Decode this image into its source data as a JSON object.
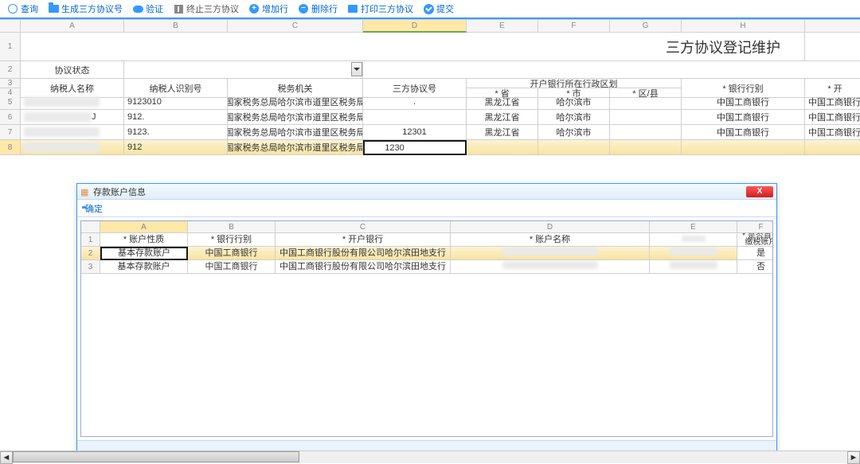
{
  "toolbar": [
    {
      "icon": "circle",
      "label": "查询"
    },
    {
      "icon": "folder",
      "label": "生成三方协议号"
    },
    {
      "icon": "cloud",
      "label": "验证"
    },
    {
      "icon": "stop",
      "label": "终止三方协议"
    },
    {
      "icon": "plus",
      "label": "增加行"
    },
    {
      "icon": "minus",
      "label": "删除行"
    },
    {
      "icon": "print",
      "label": "打印三方协议"
    },
    {
      "icon": "check",
      "label": "提交"
    }
  ],
  "col_letters": [
    "A",
    "B",
    "C",
    "D",
    "E",
    "F",
    "G",
    "H",
    ""
  ],
  "title": "三方协议登记维护",
  "status_label": "协议状态",
  "headers": {
    "taxpayer_name": "纳税人名称",
    "taxpayer_id": "纳税人识别号",
    "tax_authority": "税务机关",
    "agreement_no": "三方协议号",
    "bank_region_group": "开户银行所在行政区划",
    "province": "* 省",
    "city": "* 市",
    "district": "* 区/县",
    "bank_type": "* 银行行别",
    "open": "* 开"
  },
  "rows": [
    {
      "n": "5",
      "name": "",
      "tid": "9123010",
      "auth": "国家税务总局哈尔滨市道里区税务局",
      "agn": ".",
      "prov": "黑龙江省",
      "city": "哈尔滨市",
      "dist": "",
      "bank": "中国工商银行",
      "open": "中国工商银行"
    },
    {
      "n": "6",
      "name": "J",
      "tid": "912.",
      "auth": "国家税务总局哈尔滨市道里区税务局",
      "agn": "",
      "prov": "黑龙江省",
      "city": "哈尔滨市",
      "dist": "",
      "bank": "中国工商银行",
      "open": "中国工商银行"
    },
    {
      "n": "7",
      "name": "",
      "tid": "9123.",
      "auth": "国家税务总局哈尔滨市道里区税务局",
      "agn": "12301",
      "prov": "黑龙江省",
      "city": "哈尔滨市",
      "dist": "",
      "bank": "中国工商银行",
      "open": "中国工商银行"
    },
    {
      "n": "8",
      "name": "",
      "tid": "912",
      "auth": "国家税务总局哈尔滨市道里区税务局",
      "agn": "1230",
      "prov": "",
      "city": "",
      "dist": "",
      "bank": "",
      "open": ""
    }
  ],
  "modal": {
    "title": "存款账户信息",
    "confirm": "确定",
    "col_letters": [
      "A",
      "B",
      "C",
      "D",
      "E",
      "F"
    ],
    "headers": {
      "acct_nature": "* 账户性质",
      "bank_type": "* 银行行别",
      "open_bank": "* 开户银行",
      "acct_name": "* 账户名称",
      "acct_no_col": "",
      "preferred": "* 是否首选缴税账户"
    },
    "rows": [
      {
        "n": "2",
        "nature": "基本存款账户",
        "btype": "中国工商银行",
        "bank": "中国工商银行股份有限公司哈尔滨田地支行",
        "name": "",
        "num": " ",
        "pref": "是"
      },
      {
        "n": "3",
        "nature": "基本存款账户",
        "btype": "中国工商银行",
        "bank": "中国工商银行股份有限公司哈尔滨田地支行",
        "name": "",
        "num": " ",
        "pref": "否"
      }
    ]
  }
}
